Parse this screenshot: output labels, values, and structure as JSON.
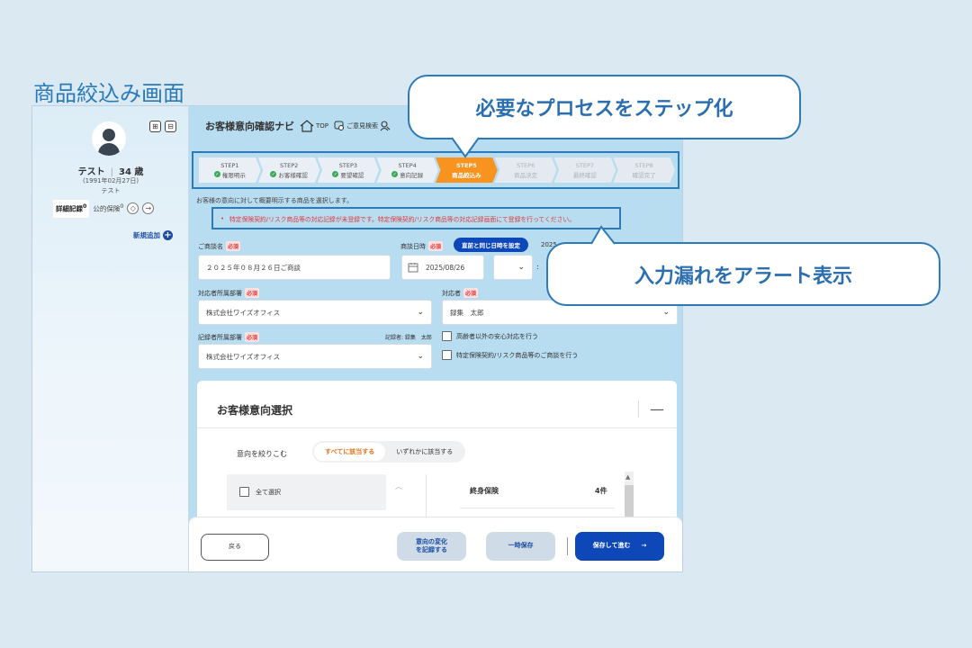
{
  "page_heading": "商品絞込み画面",
  "sidebar": {
    "name": "テスト",
    "age": "34 歳",
    "birth": "(1991年02月27日)",
    "kana": "テスト",
    "tab_active": "詳細記録",
    "tab_active_count": "0",
    "tab_other": "公的保険",
    "tab_other_count": "0",
    "new_add": "新規追加"
  },
  "header": {
    "title": "お客様意向確認ナビ",
    "top_label": "TOP",
    "search_label": "ご意見検索"
  },
  "steps": [
    {
      "num": "STEP1",
      "label": "権限明示",
      "state": "done"
    },
    {
      "num": "STEP2",
      "label": "お客様確認",
      "state": "done"
    },
    {
      "num": "STEP3",
      "label": "要望確認",
      "state": "done"
    },
    {
      "num": "STEP4",
      "label": "意向記録",
      "state": "done"
    },
    {
      "num": "STEP5",
      "label": "商品絞込み",
      "state": "current"
    },
    {
      "num": "STEP6",
      "label": "商品決定",
      "state": "future"
    },
    {
      "num": "STEP7",
      "label": "最終確認",
      "state": "future"
    },
    {
      "num": "STEP8",
      "label": "確認完了",
      "state": "future"
    }
  ],
  "instruction": "お客様の意向に対して概要明示する商品を選択します。",
  "alert": {
    "bullet": "•",
    "text": "特定保険契約/リスク商品等の対応記録が未登録です。特定保険契約/リスク商品等の対応記録画面にて登録を行ってください。"
  },
  "form": {
    "required": "必須",
    "meeting_name_label": "ご商談名",
    "meeting_name_value": "２０２５年０８月２６日ご商談",
    "meeting_date_label": "商談日時",
    "same_date_button": "直前と同じ日時を設定",
    "date_partial": "2025",
    "date_value": "2025/08/26",
    "dept_label": "対応者所属部署",
    "dept_value": "株式会社ワイズオフィス",
    "handler_label": "対応者",
    "handler_value": "録集　太郎",
    "recorder_dept_label": "記録者所属部署",
    "recorder_dept_value": "株式会社ワイズオフィス",
    "recorder_note": "記録者: 録集　太郎",
    "check_elderly": "高齢者以外の安心対応を行う",
    "check_special": "特定保険契約/リスク商品等のご商談を行う"
  },
  "panel": {
    "title": "お客様意向選択",
    "collapse": "—",
    "filter_label": "意向を絞りこむ",
    "seg_all": "すべてに該当する",
    "seg_any": "いずれかに該当する",
    "select_all": "全て選択",
    "item_name": "終身保険",
    "item_count": "4件"
  },
  "footer": {
    "back": "戻る",
    "record_change": "意向の変化\nを記録する",
    "temp_save": "一時保存",
    "save_next": "保存して進む",
    "arrow": "→"
  },
  "callouts": {
    "steps": "必要なプロセスをステップ化",
    "alert": "入力漏れをアラート表示"
  }
}
